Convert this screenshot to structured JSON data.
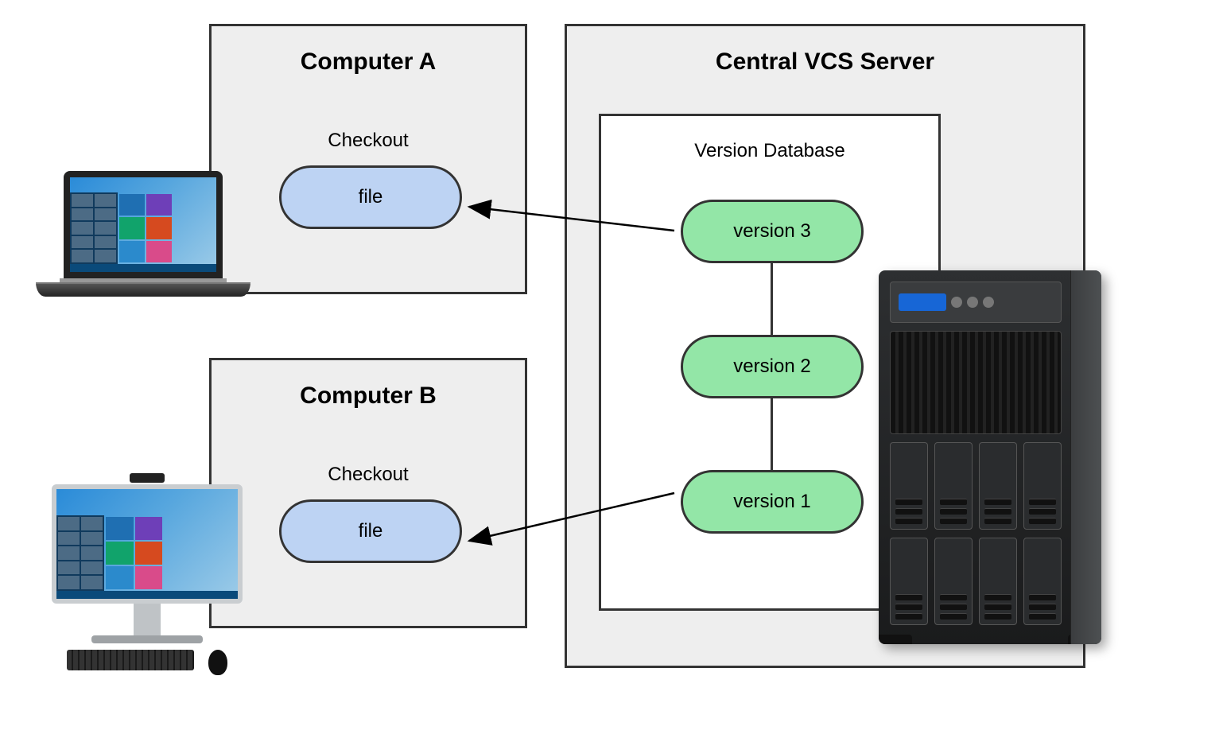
{
  "computerA": {
    "title": "Computer A",
    "checkout_label": "Checkout",
    "file_label": "file"
  },
  "computerB": {
    "title": "Computer B",
    "checkout_label": "Checkout",
    "file_label": "file"
  },
  "server": {
    "title": "Central VCS Server",
    "db_label": "Version Database",
    "versions": {
      "v3": "version 3",
      "v2": "version 2",
      "v1": "version 1"
    }
  }
}
